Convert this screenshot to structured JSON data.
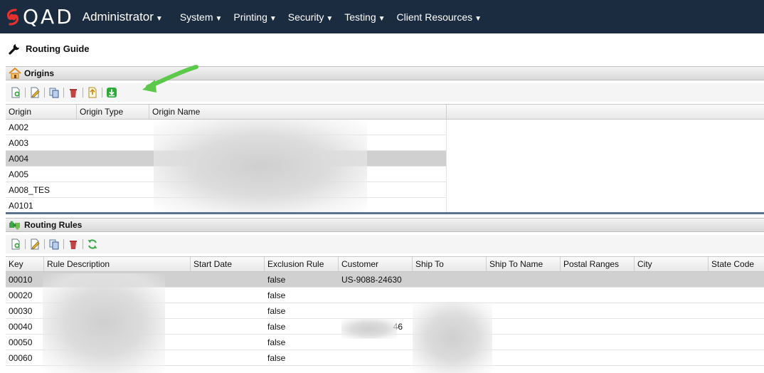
{
  "nav": {
    "logo_text": "QAD",
    "main_menu": "Administrator",
    "menus": [
      "System",
      "Printing",
      "Security",
      "Testing",
      "Client Resources"
    ]
  },
  "page": {
    "title": "Routing Guide"
  },
  "origins": {
    "panel_title": "Origins",
    "toolbar_icons": [
      "add-icon",
      "edit-icon",
      "copy-icon",
      "delete-icon",
      "export-icon",
      "download-icon"
    ],
    "columns": [
      "Origin",
      "Origin Type",
      "Origin Name"
    ],
    "rows": [
      {
        "origin": "A002",
        "origin_type": "",
        "origin_name": ""
      },
      {
        "origin": "A003",
        "origin_type": "",
        "origin_name": ""
      },
      {
        "origin": "A004",
        "origin_type": "",
        "origin_name": "",
        "selected": true
      },
      {
        "origin": "A005",
        "origin_type": "",
        "origin_name": ""
      },
      {
        "origin": "A008_TES",
        "origin_type": "",
        "origin_name": ""
      },
      {
        "origin": "A0101",
        "origin_type": "",
        "origin_name": ""
      }
    ]
  },
  "routing_rules": {
    "panel_title": "Routing Rules",
    "toolbar_icons": [
      "add-icon",
      "edit-icon",
      "copy-icon",
      "delete-icon",
      "refresh-icon"
    ],
    "columns": [
      "Key",
      "Rule Description",
      "Start Date",
      "Exclusion Rule",
      "Customer",
      "Ship To",
      "Ship To Name",
      "Postal Ranges",
      "City",
      "State Code"
    ],
    "rows": [
      {
        "key": "00010",
        "desc": "",
        "start": "",
        "excl": "false",
        "customer": "US-9088-24630",
        "shipto": "",
        "selected": true
      },
      {
        "key": "00020",
        "desc": "",
        "start": "",
        "excl": "false",
        "customer": "",
        "shipto": ""
      },
      {
        "key": "00030",
        "desc": "",
        "start": "",
        "excl": "false",
        "customer": "",
        "shipto": ""
      },
      {
        "key": "00040",
        "desc": "",
        "start": "",
        "excl": "false",
        "customer": "46",
        "shipto": ""
      },
      {
        "key": "00050",
        "desc": "",
        "start": "",
        "excl": "false",
        "customer": "",
        "shipto": ""
      },
      {
        "key": "00060",
        "desc": "",
        "start": "",
        "excl": "false",
        "customer": "",
        "shipto": ""
      }
    ]
  },
  "colors": {
    "nav_bg": "#1b2b40",
    "selected_row": "#d0d0d0",
    "arrow": "#5cc94a",
    "download_green": "#2eaa3a"
  }
}
